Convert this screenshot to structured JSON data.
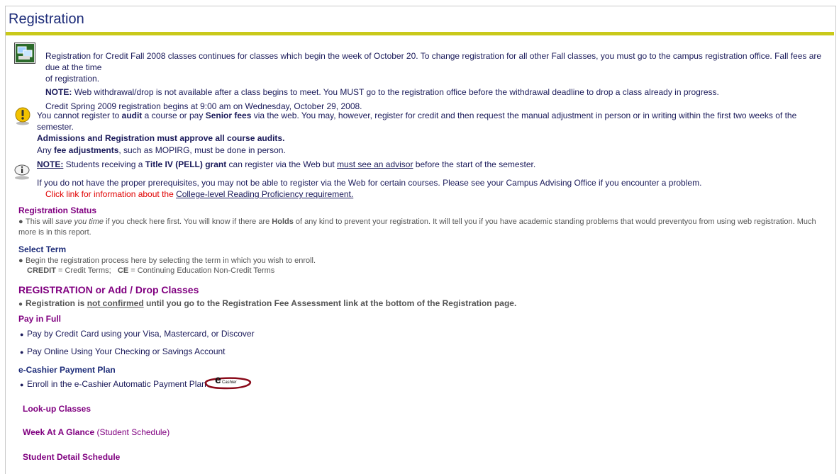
{
  "page": {
    "title": "Registration"
  },
  "notice1": {
    "text_a": "Registration for Credit Fall 2008 classes continues for classes which begin the week of October 20. To change registration for all other Fall classes, you must go to the campus registration office. Fall fees are due at the time",
    "text_b": "of registration.",
    "note_label": "NOTE:",
    "note_text": "Web withdrawal/drop is not available after a class begins to meet. You MUST go to the registration office before the withdrawal deadline to drop a class already in progress.",
    "spring_text": "Credit Spring 2009 registration begins at 9:00 am on Wednesday, October 29, 2008."
  },
  "notice2": {
    "t1": "You cannot register to ",
    "t2": "audit",
    "t3": " a course or pay ",
    "t4": "Senior fees",
    "t5": " via the web. You may, however, register for credit and then request the manual adjustment in person or in writing within the first two weeks of the semester.",
    "audit_bold": "Admissions and Registration must approve all course audits.",
    "fee_a": "Any ",
    "fee_b": "fee adjustments",
    "fee_c": ", such as MOPIRG, must be done in person.",
    "note_label": "NOTE:",
    "n1": " Students receiving a ",
    "n2": "Title IV (PELL) grant",
    "n3": " can register via the Web but ",
    "n4": "must see an advisor",
    "n5": " before the start of the semester."
  },
  "notice3": {
    "text": "If you do not have the proper prerequisites, you may not be able to register via the Web for certain courses. Please see your Campus Advising Office if you encounter a problem.",
    "red_text": "Click link for information about the ",
    "link": "College-level Reading Proficiency requirement."
  },
  "sections": {
    "status_title": "Registration Status",
    "status_a": "This will ",
    "status_b": "save you time",
    "status_c": " if you check here first. You will know if there are ",
    "status_d": "Holds",
    "status_e": " of any kind to prevent your registration. It will tell you if you have academic standing problems that would preventyou from using web registration. Much",
    "status_f": "more is in this report.",
    "term_title": "Select Term",
    "term_desc": "Begin the registration process here by selecting the term in which you wish to enroll.",
    "term_credit_label": "CREDIT",
    "term_credit": " = Credit Terms;",
    "term_ce_label": "CE",
    "term_ce": " = Continuing Education Non-Credit Terms",
    "reg_title": "REGISTRATION or Add / Drop Classes",
    "reg_a": "Registration is ",
    "reg_b": "not confirmed",
    "reg_c": " until you go to the Registration Fee Assessment link at the bottom of the Registration page.",
    "pay_title": "Pay in Full",
    "pay_card": "Pay by Credit Card using your Visa, Mastercard, or Discover",
    "pay_online": "Pay Online Using Your Checking or Savings Account",
    "ecashier_title": "e-Cashier Payment Plan",
    "ecashier_item": "Enroll in the e-Cashier Automatic Payment Plan",
    "ecashier_logo_e": "e",
    "ecashier_logo_text": "Cashier",
    "lookup": "Look-up Classes",
    "week_title": "Week At A Glance",
    "week_sub": " (Student Schedule)",
    "detail": "Student Detail Schedule"
  },
  "bullet": "●",
  "icons": [
    "computer-icon",
    "warning-icon",
    "info-icon"
  ],
  "colors": {
    "title": "#1c2b78",
    "rule": "#c9c91a",
    "section": "#800080",
    "red": "#e00000"
  }
}
